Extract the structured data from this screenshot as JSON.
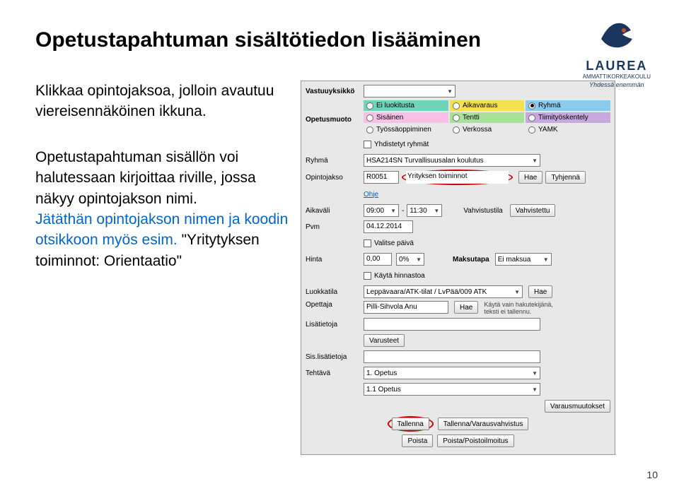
{
  "title": "Opetustapahtuman sisältötiedon lisääminen",
  "logo": {
    "name": "LAUREA",
    "sub": "AMMATTIKORKEAKOULU",
    "tagline": "Yhdessä enemmän"
  },
  "para1": {
    "p1": "Klikkaa opintojaksoa, jolloin avautuu viereisennäköinen ikkuna."
  },
  "para2": {
    "p1": "Opetustapahtuman sisällön voi halutessaan kirjoittaa riville, jossa näkyy opintojakson nimi.",
    "p2a": "Jätäthän opintojakson nimen ja koodin otsikkoon myös esim.",
    "p2b": " \"Yritytyksen toiminnot: Orientaatio\""
  },
  "panel": {
    "labels": {
      "vastuuyksikko": "Vastuuyksikkö",
      "opetusmuoto": "Opetusmuoto",
      "ryhma": "Ryhmä",
      "opintojakso": "Opintojakso",
      "aikavali": "Aikaväli",
      "pvm": "Pvm",
      "hinta": "Hinta",
      "luokkatila": "Luokkatila",
      "opettaja": "Opettaja",
      "lisatietoja": "Lisätietoja",
      "sislisatietoja": "Sis.lisätietoja",
      "tehtava": "Tehtävä",
      "vahvistustila": "Vahvistustila",
      "maksutapa": "Maksutapa",
      "varausmuutokset": "Varausmuutokset",
      "yhdistetyt": "Yhdistetyt ryhmät"
    },
    "radios": {
      "ei_luokitusta": "Ei luokitusta",
      "aikavaraus": "Aikavaraus",
      "ryhma": "Ryhmä",
      "sisainen": "Sisäinen",
      "tentti": "Tentti",
      "tiimityoskentely": "Tiimityöskentely",
      "tyossaoppiminen": "Työssäoppiminen",
      "verkossa": "Verkossa",
      "yamk": "YAMK"
    },
    "values": {
      "ryhma": "HSA214SN Turvallisuusalan koulutus",
      "opintojakso_code": "R0051",
      "opintojakso_name": "Yrityksen toiminnot",
      "ohje": "Ohje",
      "aika_from": "09:00",
      "aika_sep": "-",
      "aika_to": "11:30",
      "vahvistustila_val": "Vahvistettu",
      "pvm_date": "04.12.2014",
      "pvm_valitse": "Valitse päivä",
      "hinta_val": "0,00",
      "hinta_pct": "0%",
      "hinta_chk": "Käytä hinnastoa",
      "maksutapa_val": "Ei maksua",
      "luokkatila_val": "Leppävaara/ATK-tilat / LvPää/009 ATK",
      "opettaja_val": "Pilli-Sihvola Anu",
      "opettaja_hint": "Käytä vain hakutekijänä, teksti ei tallennu.",
      "varusteet": "Varusteet",
      "tehtava1": "1. Opetus",
      "tehtava2": "1.1 Opetus"
    },
    "buttons": {
      "hae": "Hae",
      "tyhjenna": "Tyhjennä",
      "tallenna": "Tallenna",
      "tallenna_varaus": "Tallenna/Varausvahvistus",
      "poista": "Poista",
      "poista_ilmoitus": "Poista/Poistoilmoitus"
    }
  },
  "page_num": "10"
}
